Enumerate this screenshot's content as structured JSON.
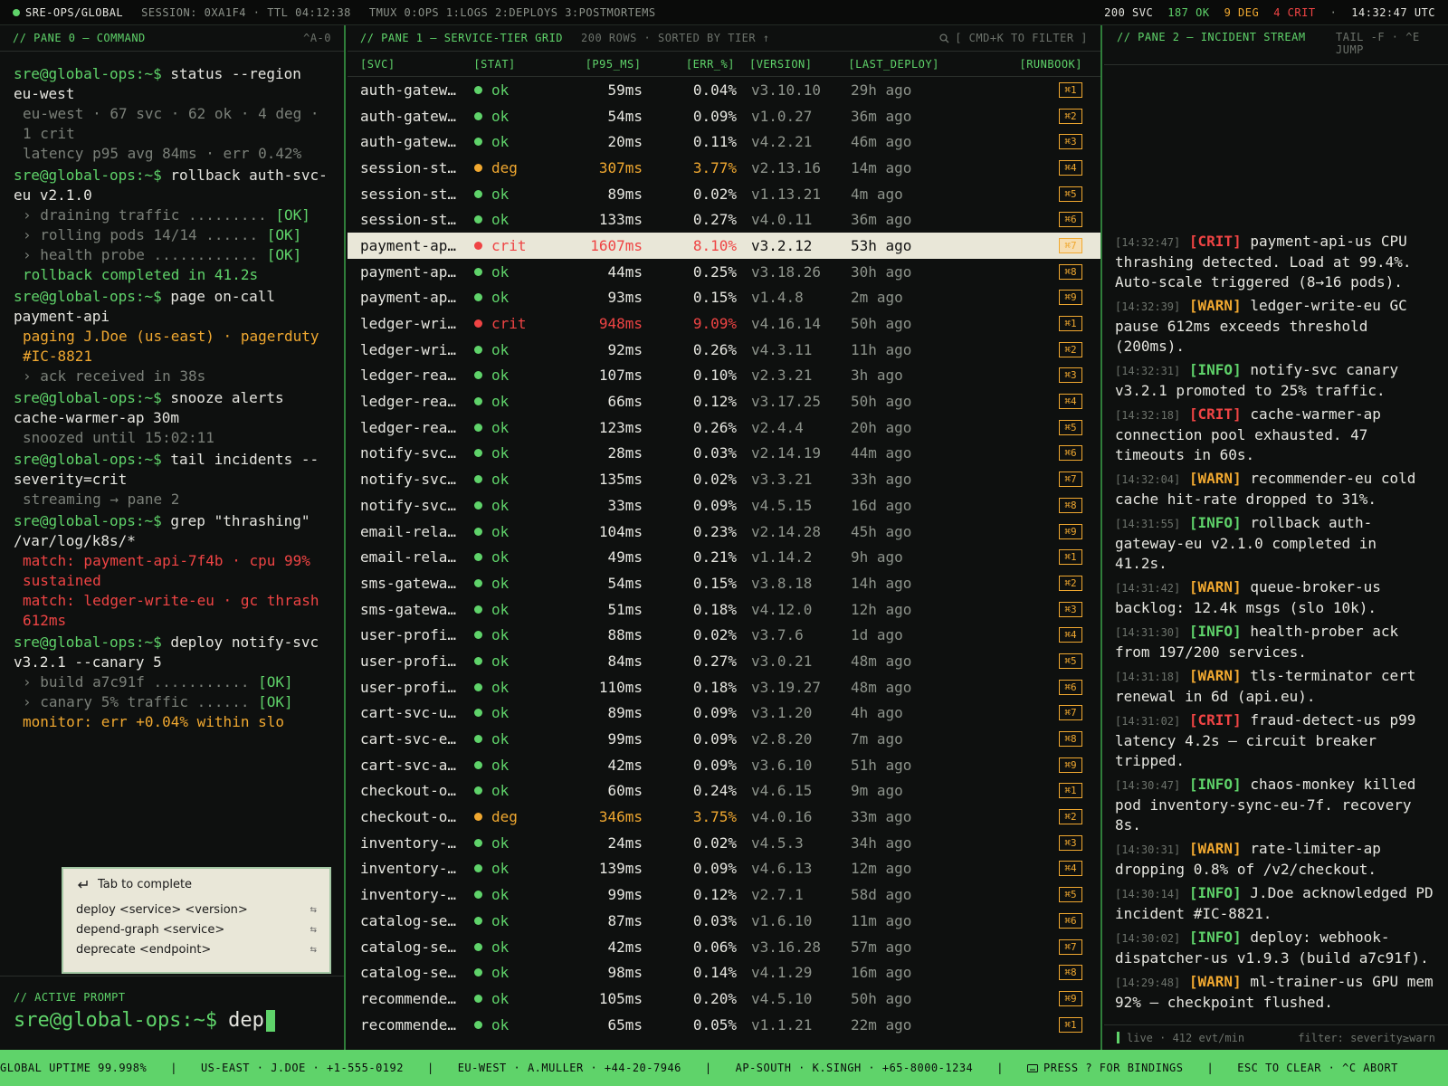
{
  "topbar": {
    "brand": "SRE-OPS/GLOBAL",
    "session": "SESSION: 0XA1F4 · TTL 04:12:38",
    "tmux": "TMUX 0:OPS 1:LOGS 2:DEPLOYS 3:POSTMORTEMS",
    "svc": "200 SVC",
    "ok": "187 OK",
    "deg": "9 DEG",
    "crit": "4 CRIT",
    "time": "14:32:47 UTC"
  },
  "pane0": {
    "title": "// PANE 0 — COMMAND",
    "hint": "^A-0",
    "prompt": "sre@global-ops:~$",
    "lines": [
      {
        "type": "cmd",
        "text": "status --region eu-west"
      },
      {
        "type": "out",
        "text": "eu-west · 67 svc · 62 ok · 4 deg · 1 crit"
      },
      {
        "type": "out",
        "text": "latency p95 avg 84ms · err 0.42%"
      },
      {
        "type": "cmd",
        "text": "rollback auth-svc-eu v2.1.0"
      },
      {
        "type": "step",
        "text": "› draining traffic .........",
        "ok": "[OK]"
      },
      {
        "type": "step",
        "text": "› rolling pods 14/14 ......",
        "ok": "[OK]"
      },
      {
        "type": "step",
        "text": "› health probe ............",
        "ok": "[OK]"
      },
      {
        "type": "ok",
        "text": "rollback completed in 41.2s"
      },
      {
        "type": "cmd",
        "text": "page on-call payment-api"
      },
      {
        "type": "warn",
        "text": "paging J.Doe (us-east) · pagerduty #IC-8821"
      },
      {
        "type": "out",
        "text": "› ack received in 38s"
      },
      {
        "type": "cmd",
        "text": "snooze alerts cache-warmer-ap 30m"
      },
      {
        "type": "out",
        "text": "snoozed until 15:02:11"
      },
      {
        "type": "cmd",
        "text": "tail incidents --severity=crit"
      },
      {
        "type": "out",
        "text": "streaming → pane 2"
      },
      {
        "type": "cmd",
        "text": "grep \"thrashing\" /var/log/k8s/*"
      },
      {
        "type": "err",
        "text": "match: payment-api-7f4b · cpu 99% sustained"
      },
      {
        "type": "err",
        "text": "match: ledger-write-eu · gc thrash 612ms"
      },
      {
        "type": "cmd",
        "text": "deploy notify-svc v3.2.1 --canary 5"
      },
      {
        "type": "step",
        "text": "› build a7c91f ...........",
        "ok": "[OK]"
      },
      {
        "type": "step",
        "text": "› canary 5% traffic ......",
        "ok": "[OK]"
      },
      {
        "type": "warn",
        "text": "monitor: err +0.04% within slo"
      }
    ],
    "popup": {
      "header": "Tab to complete",
      "items": [
        "deploy <service> <version>",
        "depend-graph <service>",
        "deprecate <endpoint>"
      ],
      "key": "⇆"
    },
    "active_label": "// ACTIVE PROMPT",
    "typed": "dep"
  },
  "pane1": {
    "title": "// PANE 1 — SERVICE-TIER GRID",
    "meta": "200 ROWS · SORTED BY TIER ↑",
    "filter": "[ CMD+K TO FILTER ]",
    "columns": [
      "[SVC]",
      "[STAT]",
      "[P95_MS]",
      "[ERR_%]",
      "[VERSION]",
      "[LAST_DEPLOY]",
      "[RUNBOOK]"
    ],
    "rows": [
      [
        "auth-gatew…",
        "ok",
        "59ms",
        "0.04%",
        "v3.10.10",
        "29h ago",
        "⌘1"
      ],
      [
        "auth-gatew…",
        "ok",
        "54ms",
        "0.09%",
        "v1.0.27",
        "36m ago",
        "⌘2"
      ],
      [
        "auth-gatew…",
        "ok",
        "20ms",
        "0.11%",
        "v4.2.21",
        "46m ago",
        "⌘3"
      ],
      [
        "session-st…",
        "deg",
        "307ms",
        "3.77%",
        "v2.13.16",
        "14m ago",
        "⌘4"
      ],
      [
        "session-st…",
        "ok",
        "89ms",
        "0.02%",
        "v1.13.21",
        "4m ago",
        "⌘5"
      ],
      [
        "session-st…",
        "ok",
        "133ms",
        "0.27%",
        "v4.0.11",
        "36m ago",
        "⌘6"
      ],
      [
        "payment-ap…",
        "crit",
        "1607ms",
        "8.10%",
        "v3.2.12",
        "53h ago",
        "⌘7"
      ],
      [
        "payment-ap…",
        "ok",
        "44ms",
        "0.25%",
        "v3.18.26",
        "30h ago",
        "⌘8"
      ],
      [
        "payment-ap…",
        "ok",
        "93ms",
        "0.15%",
        "v1.4.8",
        "2m ago",
        "⌘9"
      ],
      [
        "ledger-wri…",
        "crit",
        "948ms",
        "9.09%",
        "v4.16.14",
        "50h ago",
        "⌘1"
      ],
      [
        "ledger-wri…",
        "ok",
        "92ms",
        "0.26%",
        "v4.3.11",
        "11h ago",
        "⌘2"
      ],
      [
        "ledger-rea…",
        "ok",
        "107ms",
        "0.10%",
        "v2.3.21",
        "3h ago",
        "⌘3"
      ],
      [
        "ledger-rea…",
        "ok",
        "66ms",
        "0.12%",
        "v3.17.25",
        "50h ago",
        "⌘4"
      ],
      [
        "ledger-rea…",
        "ok",
        "123ms",
        "0.26%",
        "v2.4.4",
        "20h ago",
        "⌘5"
      ],
      [
        "notify-svc…",
        "ok",
        "28ms",
        "0.03%",
        "v2.14.19",
        "44m ago",
        "⌘6"
      ],
      [
        "notify-svc…",
        "ok",
        "135ms",
        "0.02%",
        "v3.3.21",
        "33h ago",
        "⌘7"
      ],
      [
        "notify-svc…",
        "ok",
        "33ms",
        "0.09%",
        "v4.5.15",
        "16d ago",
        "⌘8"
      ],
      [
        "email-rela…",
        "ok",
        "104ms",
        "0.23%",
        "v2.14.28",
        "45h ago",
        "⌘9"
      ],
      [
        "email-rela…",
        "ok",
        "49ms",
        "0.21%",
        "v1.14.2",
        "9h ago",
        "⌘1"
      ],
      [
        "sms-gatewa…",
        "ok",
        "54ms",
        "0.15%",
        "v3.8.18",
        "14h ago",
        "⌘2"
      ],
      [
        "sms-gatewa…",
        "ok",
        "51ms",
        "0.18%",
        "v4.12.0",
        "12h ago",
        "⌘3"
      ],
      [
        "user-profi…",
        "ok",
        "88ms",
        "0.02%",
        "v3.7.6",
        "1d ago",
        "⌘4"
      ],
      [
        "user-profi…",
        "ok",
        "84ms",
        "0.27%",
        "v3.0.21",
        "48m ago",
        "⌘5"
      ],
      [
        "user-profi…",
        "ok",
        "110ms",
        "0.18%",
        "v3.19.27",
        "48m ago",
        "⌘6"
      ],
      [
        "cart-svc-u…",
        "ok",
        "89ms",
        "0.09%",
        "v3.1.20",
        "4h ago",
        "⌘7"
      ],
      [
        "cart-svc-e…",
        "ok",
        "99ms",
        "0.09%",
        "v2.8.20",
        "7m ago",
        "⌘8"
      ],
      [
        "cart-svc-a…",
        "ok",
        "42ms",
        "0.09%",
        "v3.6.10",
        "51h ago",
        "⌘9"
      ],
      [
        "checkout-o…",
        "ok",
        "60ms",
        "0.24%",
        "v4.6.15",
        "9m ago",
        "⌘1"
      ],
      [
        "checkout-o…",
        "deg",
        "346ms",
        "3.75%",
        "v4.0.16",
        "33m ago",
        "⌘2"
      ],
      [
        "inventory-…",
        "ok",
        "24ms",
        "0.02%",
        "v4.5.3",
        "34h ago",
        "⌘3"
      ],
      [
        "inventory-…",
        "ok",
        "139ms",
        "0.09%",
        "v4.6.13",
        "12m ago",
        "⌘4"
      ],
      [
        "inventory-…",
        "ok",
        "99ms",
        "0.12%",
        "v2.7.1",
        "58d ago",
        "⌘5"
      ],
      [
        "catalog-se…",
        "ok",
        "87ms",
        "0.03%",
        "v1.6.10",
        "11m ago",
        "⌘6"
      ],
      [
        "catalog-se…",
        "ok",
        "42ms",
        "0.06%",
        "v3.16.28",
        "57m ago",
        "⌘7"
      ],
      [
        "catalog-se…",
        "ok",
        "98ms",
        "0.14%",
        "v4.1.29",
        "16m ago",
        "⌘8"
      ],
      [
        "recommende…",
        "ok",
        "105ms",
        "0.20%",
        "v4.5.10",
        "50h ago",
        "⌘9"
      ],
      [
        "recommende…",
        "ok",
        "65ms",
        "0.05%",
        "v1.1.21",
        "22m ago",
        "⌘1"
      ]
    ],
    "selected_index": 6
  },
  "pane2": {
    "title": "// PANE 2 — INCIDENT STREAM",
    "hint": "TAIL -F · ^E JUMP",
    "events": [
      {
        "ts": "[14:32:47]",
        "sev": "CRIT",
        "msg": "payment-api-us CPU thrashing detected. Load at 99.4%. Auto-scale triggered (8→16 pods)."
      },
      {
        "ts": "[14:32:39]",
        "sev": "WARN",
        "msg": "ledger-write-eu GC pause 612ms exceeds threshold (200ms)."
      },
      {
        "ts": "[14:32:31]",
        "sev": "INFO",
        "msg": "notify-svc canary v3.2.1 promoted to 25% traffic."
      },
      {
        "ts": "[14:32:18]",
        "sev": "CRIT",
        "msg": "cache-warmer-ap connection pool exhausted. 47 timeouts in 60s."
      },
      {
        "ts": "[14:32:04]",
        "sev": "WARN",
        "msg": "recommender-eu cold cache hit-rate dropped to 31%."
      },
      {
        "ts": "[14:31:55]",
        "sev": "INFO",
        "msg": "rollback auth-gateway-eu v2.1.0 completed in 41.2s."
      },
      {
        "ts": "[14:31:42]",
        "sev": "WARN",
        "msg": "queue-broker-us backlog: 12.4k msgs (slo 10k)."
      },
      {
        "ts": "[14:31:30]",
        "sev": "INFO",
        "msg": "health-prober ack from 197/200 services."
      },
      {
        "ts": "[14:31:18]",
        "sev": "WARN",
        "msg": "tls-terminator cert renewal in 6d (api.eu)."
      },
      {
        "ts": "[14:31:02]",
        "sev": "CRIT",
        "msg": "fraud-detect-us p99 latency 4.2s — circuit breaker tripped."
      },
      {
        "ts": "[14:30:47]",
        "sev": "INFO",
        "msg": "chaos-monkey killed pod inventory-sync-eu-7f. recovery 8s."
      },
      {
        "ts": "[14:30:31]",
        "sev": "WARN",
        "msg": "rate-limiter-ap dropping 0.8% of /v2/checkout."
      },
      {
        "ts": "[14:30:14]",
        "sev": "INFO",
        "msg": "J.Doe acknowledged PD incident #IC-8821."
      },
      {
        "ts": "[14:30:02]",
        "sev": "INFO",
        "msg": "deploy: webhook-dispatcher-us v1.9.3 (build a7c91f)."
      },
      {
        "ts": "[14:29:48]",
        "sev": "WARN",
        "msg": "ml-trainer-us GPU mem 92% — checkpoint flushed."
      }
    ],
    "footer_live": "live · 412 evt/min",
    "footer_filter": "filter: severity≥warn"
  },
  "bottom": {
    "uptime": "GLOBAL UPTIME 99.998%",
    "oncall": [
      "US-EAST · J.DOE · +1-555-0192",
      "EU-WEST · A.MULLER · +44-20-7946",
      "AP-SOUTH · K.SINGH · +65-8000-1234"
    ],
    "help": "PRESS ? FOR BINDINGS",
    "esc": "ESC TO CLEAR · ^C ABORT"
  },
  "colors": {
    "accent": "#5fd36a",
    "warn": "#f0a830",
    "crit": "#ef4444",
    "bg": "#0e100f"
  },
  "icons": {
    "search": "search-icon",
    "return": "return-icon",
    "keyboard": "keyboard-icon"
  }
}
